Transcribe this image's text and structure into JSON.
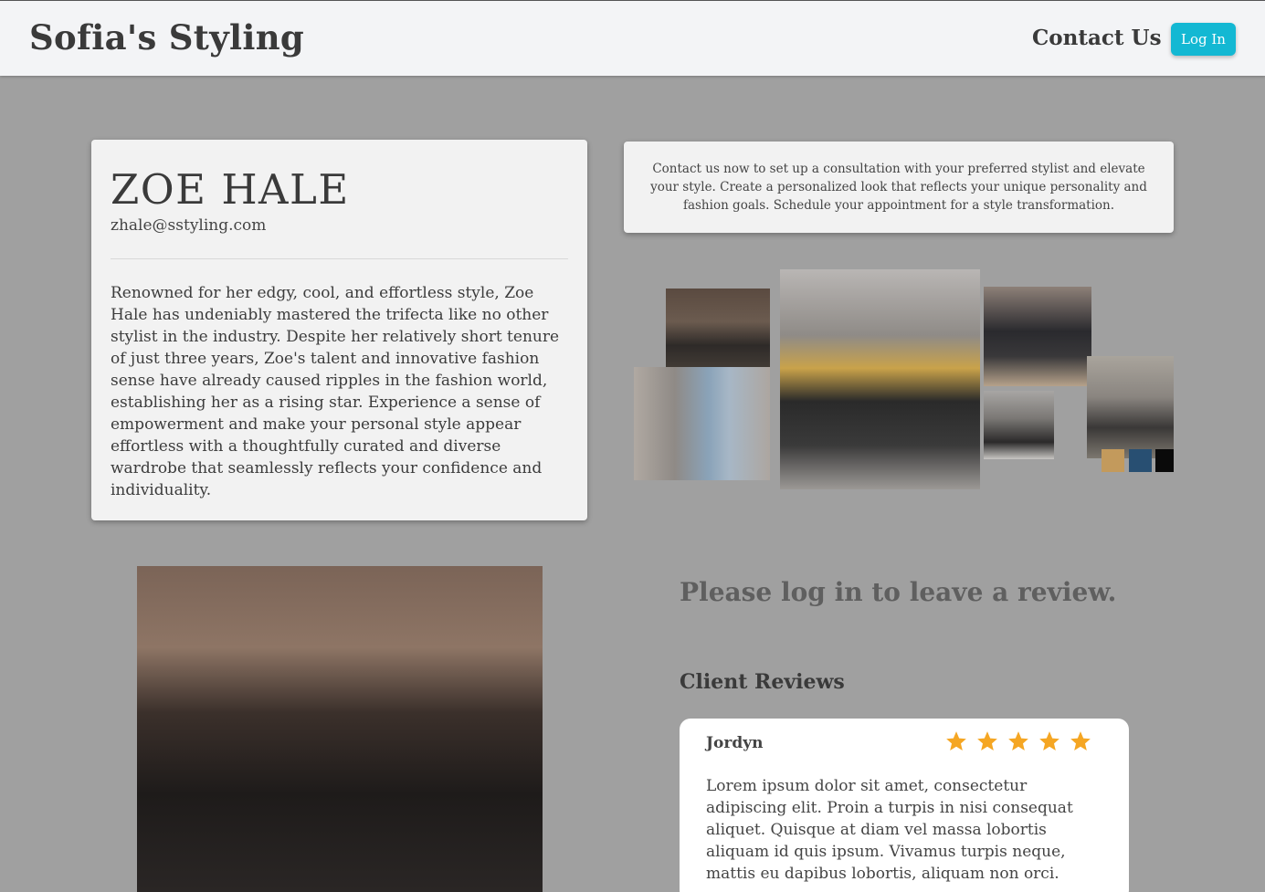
{
  "navbar": {
    "brand": "Sofia's Styling",
    "contact_label": "Contact Us",
    "login_label": "Log In"
  },
  "profile": {
    "name": "ZOE HALE",
    "email": "zhale@sstyling.com",
    "bio": "Renowned for her edgy, cool, and effortless style, Zoe Hale has undeniably mastered the trifecta like no other stylist in the industry. Despite her relatively short tenure of just three years, Zoe's talent and innovative fashion sense have already caused ripples in the fashion world, establishing her as a rising star. Experience a sense of empowerment and make your personal style appear effortless with a thoughtfully curated and diverse wardrobe that seamlessly reflects your confidence and individuality."
  },
  "contact_blurb": "Contact us now to set up a consultation with your preferred stylist and elevate your style. Create a personalized look that reflects your unique personality and fashion goals. Schedule your appointment for a style transformation.",
  "moodboard": {
    "swatches": [
      "#c39a5c",
      "#284f72",
      "#0a0a0a"
    ]
  },
  "reviews": {
    "prompt": "Please log in to leave a review.",
    "heading": "Client Reviews",
    "items": [
      {
        "name": "Jordyn",
        "rating": 5,
        "text": "Lorem ipsum dolor sit amet, consectetur adipiscing elit. Proin a turpis in nisi consequat aliquet. Quisque at diam vel massa lobortis aliquam id quis ipsum. Vivamus turpis neque, mattis eu dapibus lobortis, aliquam non orci."
      }
    ]
  },
  "colors": {
    "accent": "#13b8d3",
    "star": "#f5a623",
    "background": "#a0a0a0"
  }
}
